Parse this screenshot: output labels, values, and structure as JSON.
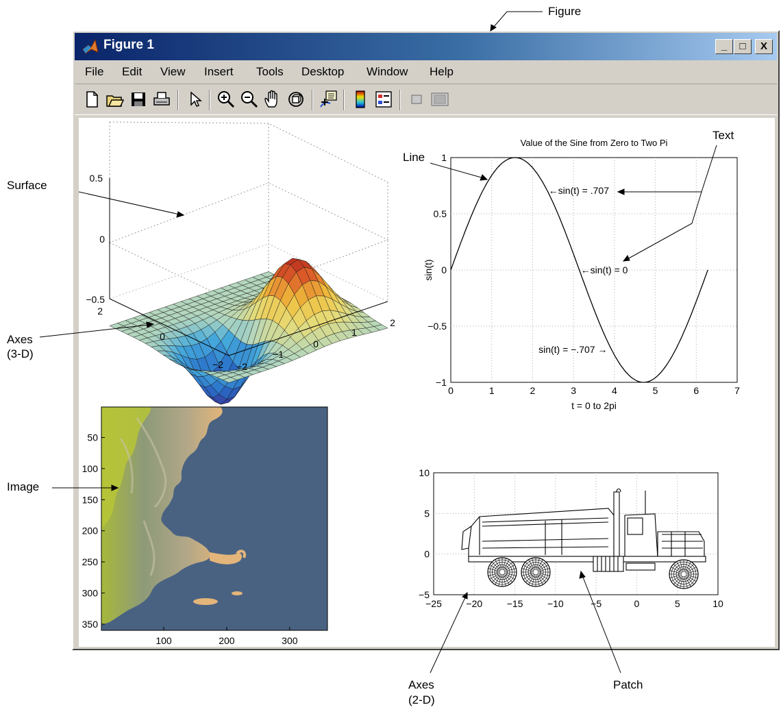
{
  "window": {
    "title": "Figure 1",
    "minimize": "_",
    "maximize": "□",
    "close": "X"
  },
  "menu": [
    "File",
    "Edit",
    "View",
    "Insert",
    "Tools",
    "Desktop",
    "Window",
    "Help"
  ],
  "toolbar_icons": [
    "new-file-icon",
    "open-folder-icon",
    "save-icon",
    "print-icon",
    "pointer-icon",
    "zoom-in-icon",
    "zoom-out-icon",
    "pan-hand-icon",
    "rotate-3d-icon",
    "data-cursor-icon",
    "colorbar-icon",
    "legend-icon",
    "hide-plot-tools-icon",
    "show-plot-tools-icon"
  ],
  "annotations": {
    "figure": "Figure",
    "surface": "Surface",
    "axes3d_line1": "Axes",
    "axes3d_line2": "(3-D)",
    "image": "Image",
    "line": "Line",
    "text": "Text",
    "axes2d_line1": "Axes",
    "axes2d_line2": "(2-D)",
    "patch": "Patch"
  },
  "surface_axes": {
    "z_ticks": [
      "0.5",
      "0",
      "−0.5"
    ],
    "y_ticks": [
      "2",
      "0",
      "−2"
    ],
    "x_ticks": [
      "−2",
      "−1",
      "0",
      "1",
      "2"
    ]
  },
  "chart_data": [
    {
      "type": "line",
      "title": "Value of the Sine from Zero to Two Pi",
      "xlabel": "t = 0 to 2pi",
      "ylabel": "sin(t)",
      "xlim": [
        0,
        7
      ],
      "ylim": [
        -1,
        1
      ],
      "x_ticks": [
        "0",
        "1",
        "2",
        "3",
        "4",
        "5",
        "6",
        "7"
      ],
      "y_ticks": [
        "1",
        "0.5",
        "0",
        "−0.5",
        "−1"
      ],
      "grid": true,
      "series": [
        {
          "function": "sin(t)",
          "t_range": [
            0,
            6.283
          ]
        }
      ],
      "labels": [
        {
          "text": "←sin(t) = .707",
          "x": 2.356,
          "y": 0.707
        },
        {
          "text": "←sin(t) = 0",
          "x": 3.1416,
          "y": 0
        },
        {
          "text": "sin(t) = −.707 →",
          "x": 3.927,
          "y": -0.707
        }
      ]
    },
    {
      "type": "heatmap",
      "x_ticks": [
        "100",
        "200",
        "300"
      ],
      "y_ticks": [
        "50",
        "100",
        "150",
        "200",
        "250",
        "300",
        "350"
      ],
      "xlim": [
        1,
        360
      ],
      "ylim": [
        1,
        360
      ]
    },
    {
      "type": "scatter",
      "xlim": [
        -25,
        10
      ],
      "ylim": [
        -5,
        10
      ],
      "x_ticks": [
        "−25",
        "−20",
        "−15",
        "−10",
        "−5",
        "0",
        "5",
        "10"
      ],
      "y_ticks": [
        "10",
        "5",
        "0",
        "−5"
      ],
      "grid": true
    }
  ],
  "colors": {
    "titlebar_start": "#0a246a",
    "titlebar_end": "#a6caf0",
    "window_face": "#d4d0c8",
    "ocean": "#4a6282",
    "land_light": "#e8b87a",
    "land_high": "#b6c33a"
  }
}
